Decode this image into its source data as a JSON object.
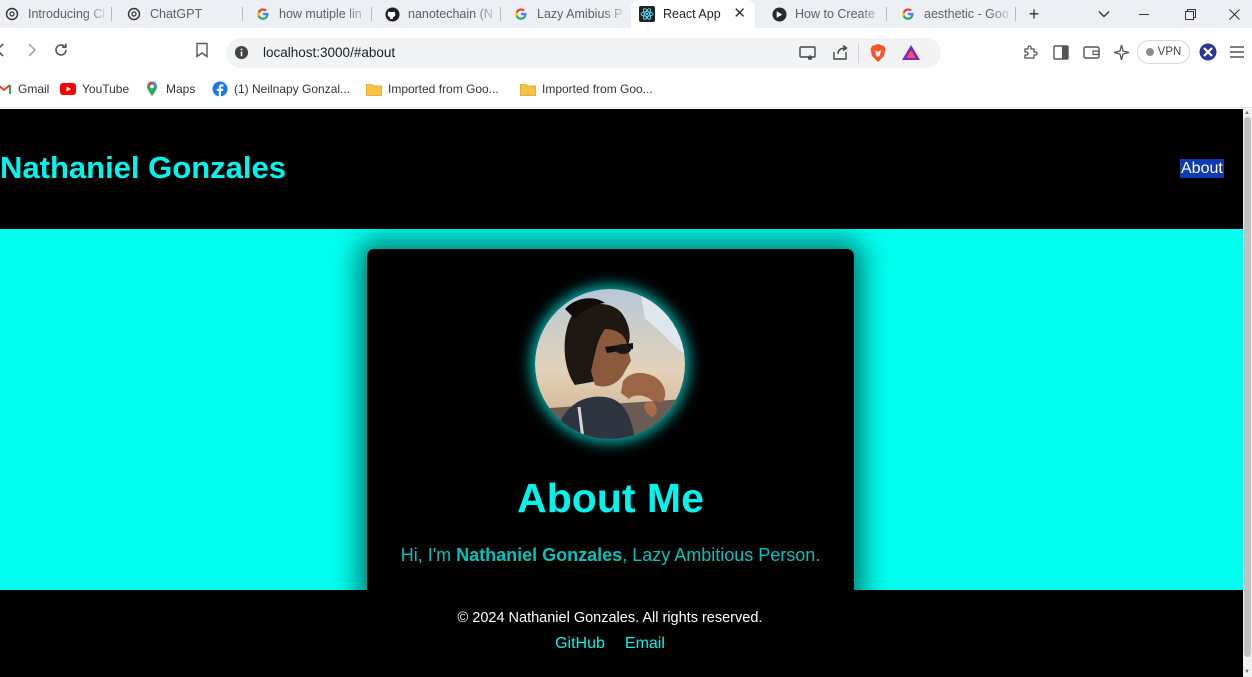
{
  "browser": {
    "tabs": [
      {
        "label": "Introducing Ch",
        "icon": "openai-icon"
      },
      {
        "label": "ChatGPT",
        "icon": "openai-icon"
      },
      {
        "label": "how mutiple lin",
        "icon": "google-icon"
      },
      {
        "label": "nanotechain (N",
        "icon": "github-icon"
      },
      {
        "label": "Lazy Amibius P",
        "icon": "google-icon"
      },
      {
        "label": "React App",
        "icon": "react-icon"
      },
      {
        "label": "How to Create",
        "icon": "perplexity-icon"
      },
      {
        "label": "aesthetic - Goo",
        "icon": "google-icon"
      }
    ],
    "url": "localhost:3000/#about",
    "vpn_label": "VPN",
    "bookmarks": [
      {
        "label": "Gmail",
        "icon": "gmail-icon"
      },
      {
        "label": "YouTube",
        "icon": "youtube-icon"
      },
      {
        "label": "Maps",
        "icon": "maps-icon"
      },
      {
        "label": "(1) Neilnapy Gonzal...",
        "icon": "facebook-icon"
      },
      {
        "label": "Imported from Goo...",
        "icon": "folder-icon"
      },
      {
        "label": "Imported from Goo...",
        "icon": "folder-icon"
      }
    ]
  },
  "site": {
    "title": "Nathaniel Gonzales",
    "nav_about": "About"
  },
  "about": {
    "heading": "About Me",
    "intro_prefix": "Hi, I'm ",
    "intro_name": "Nathaniel Gonzales",
    "intro_suffix": ", Lazy Ambitious Person."
  },
  "footer": {
    "copyright": "© 2024 Nathaniel Gonzales. All rights reserved.",
    "github": "GitHub",
    "email": "Email"
  },
  "colors": {
    "accent": "#00f5ee",
    "page_bg": "#00fff0",
    "header_bg": "#000000"
  }
}
